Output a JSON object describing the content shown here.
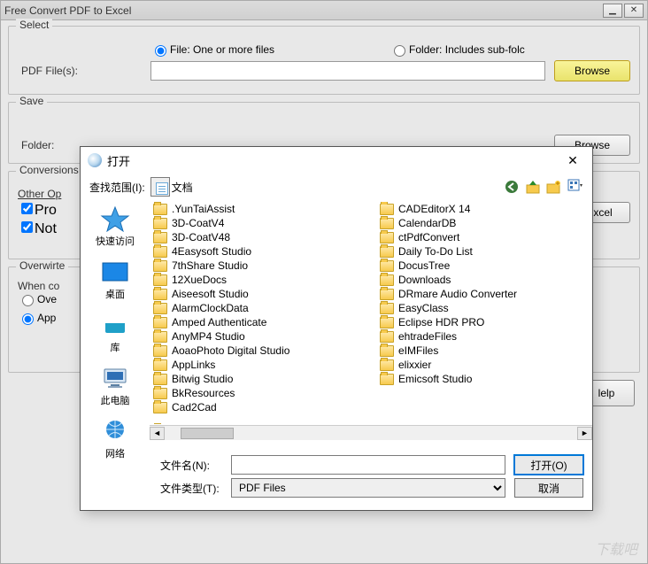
{
  "window": {
    "title": "Free Convert PDF to Excel"
  },
  "select": {
    "legend": "Select",
    "file_radio": "File:  One or more files",
    "folder_radio": "Folder: Includes sub-folc",
    "pdf_files_label": "PDF File(s):",
    "browse": "Browse"
  },
  "save": {
    "legend": "Save",
    "folder_label": "Folder:",
    "browse": "Browse"
  },
  "conversions": {
    "legend": "Conversions",
    "other_legend": "Other Op",
    "pro_check": "Pro",
    "not_check": "Not",
    "to_excel": "To  Excel"
  },
  "overwrite": {
    "legend": "Overwirte",
    "when_label": "When co",
    "ove_radio": "Ove",
    "app_radio": "App"
  },
  "help_btn": "lelp",
  "dialog": {
    "title": "打开",
    "lookin_label": "查找范围(I):",
    "lookin_value": "文档",
    "places": {
      "quick": "快速访问",
      "desktop": "桌面",
      "library": "库",
      "pc": "此电脑",
      "network": "网络"
    },
    "folders_col1": [
      ".YunTaiAssist",
      "3D-CoatV4",
      "3D-CoatV48",
      "4Easysoft Studio",
      "7thShare Studio",
      "12XueDocs",
      "Aiseesoft Studio",
      "AlarmClockData",
      "Amped Authenticate",
      "AnyMP4 Studio",
      "AoaoPhoto Digital Studio",
      "AppLinks",
      "Bitwig Studio",
      "BkResources"
    ],
    "folders_col2": [
      "Cad2Cad",
      "CADEditorX 14",
      "CalendarDB",
      "ctPdfConvert",
      "Daily To-Do List",
      "DocusTree",
      "Downloads",
      "DRmare Audio Converter",
      "EasyClass",
      "Eclipse HDR PRO",
      "ehtradeFiles",
      "eIMFiles",
      "elixxier",
      "Emicsoft Studio"
    ],
    "filename_label": "文件名(N):",
    "filetype_label": "文件类型(T):",
    "filetype_value": "PDF Files",
    "open_btn": "打开(O)",
    "cancel_btn": "取消"
  },
  "watermark": "下载吧"
}
